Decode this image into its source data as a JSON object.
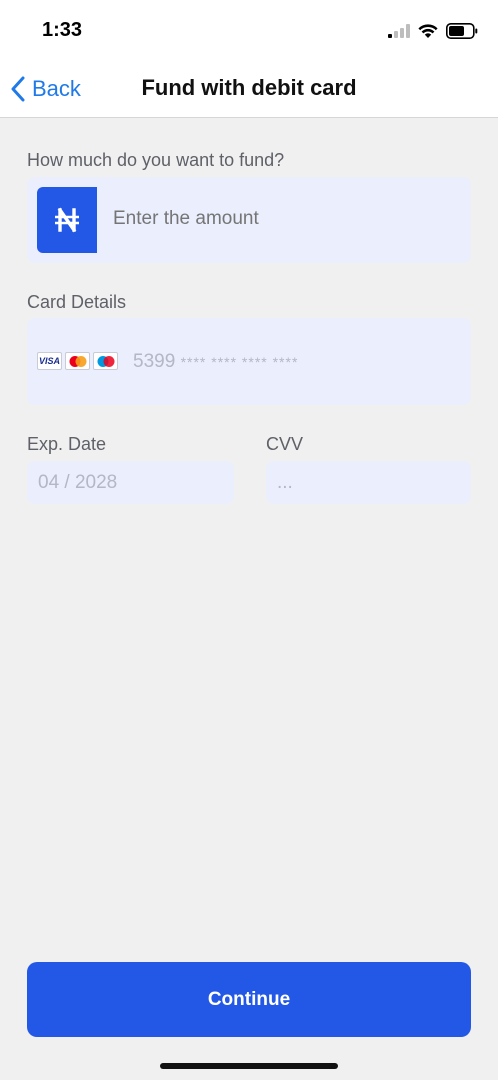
{
  "status_bar": {
    "time": "1:33",
    "icons": [
      "signal-icon",
      "wifi-icon",
      "battery-icon"
    ]
  },
  "nav": {
    "back_label": "Back",
    "title": "Fund with debit card",
    "accent_color": "#1f7ae8"
  },
  "amount": {
    "label": "How much do you want to fund?",
    "currency_symbol": "₦",
    "placeholder": "Enter the amount"
  },
  "card": {
    "label": "Card Details",
    "brands": [
      "visa-icon",
      "mastercard-icon",
      "maestro-icon"
    ],
    "visa_text": "VISA",
    "number_prefix": "5399",
    "number_mask": "**** **** **** ****"
  },
  "expiry": {
    "label": "Exp. Date",
    "value": "04 / 2028"
  },
  "cvv": {
    "label": "CVV",
    "value": "..."
  },
  "continue_button": {
    "label": "Continue",
    "color": "#2358e7"
  }
}
